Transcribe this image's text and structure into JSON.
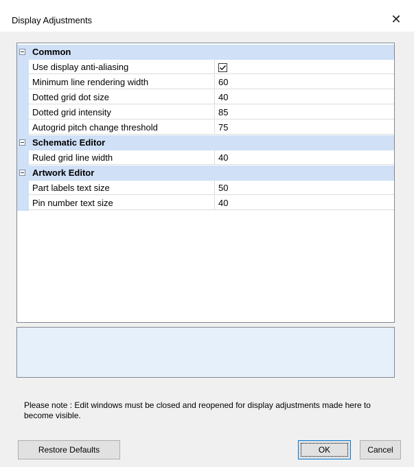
{
  "window": {
    "title": "Display Adjustments"
  },
  "grid": {
    "categories": [
      {
        "label": "Common",
        "properties": [
          {
            "name": "Use display anti-aliasing",
            "value": "",
            "checked": true
          },
          {
            "name": "Minimum line rendering width",
            "value": "60"
          },
          {
            "name": "Dotted grid dot size",
            "value": "40"
          },
          {
            "name": "Dotted grid intensity",
            "value": "85"
          },
          {
            "name": "Autogrid pitch change threshold",
            "value": "75"
          }
        ]
      },
      {
        "label": "Schematic Editor",
        "properties": [
          {
            "name": "Ruled grid line width",
            "value": "40"
          }
        ]
      },
      {
        "label": "Artwork Editor",
        "properties": [
          {
            "name": "Part labels text size",
            "value": "50"
          },
          {
            "name": "Pin number text size",
            "value": "40"
          }
        ]
      }
    ]
  },
  "note": "Please note : Edit windows must be closed and reopened for display adjustments made here to become visible.",
  "buttons": {
    "restore_defaults": "Restore Defaults",
    "ok": "OK",
    "cancel": "Cancel"
  },
  "colors": {
    "category_bg": "#cfe0f7",
    "description_bg": "#e6f0fb",
    "ok_border": "#0078d7"
  }
}
